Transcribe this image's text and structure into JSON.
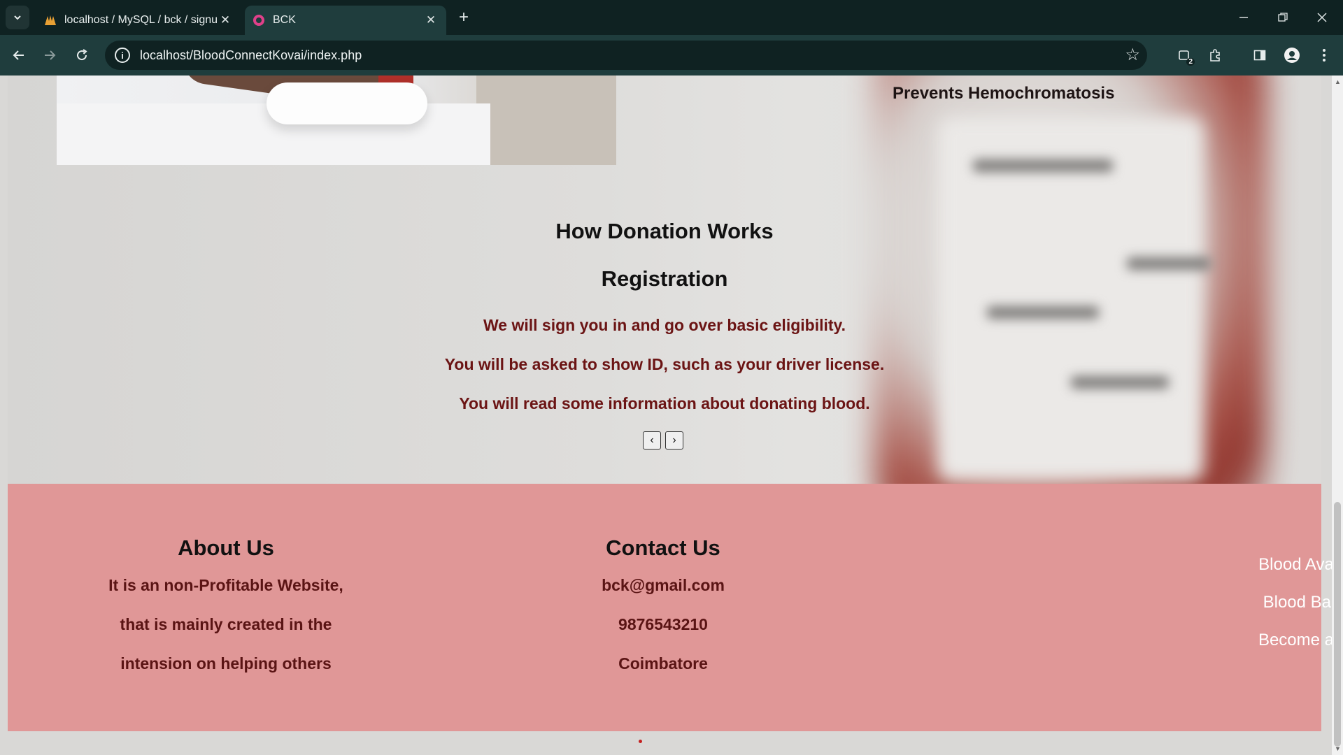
{
  "browser": {
    "tabs": [
      {
        "title": "localhost / MySQL / bck / signu",
        "active": false
      },
      {
        "title": "BCK",
        "active": true
      }
    ],
    "url": "localhost/BloodConnectKovai/index.php",
    "extension_badge": "2"
  },
  "hero": {
    "benefit_text": "Prevents Hemochromatosis",
    "section_title": "How Donation Works",
    "step_title": "Registration",
    "step_lines": [
      "We will sign you in and go over basic eligibility.",
      "You will be asked to show ID, such as your driver license.",
      "You will read some information about donating blood."
    ],
    "prev_label": "‹",
    "next_label": "›"
  },
  "footer": {
    "about": {
      "title": "About Us",
      "lines": [
        "It is an non-Profitable Website,",
        "that is mainly created in the",
        "intension on helping others"
      ]
    },
    "contact": {
      "title": "Contact Us",
      "lines": [
        "bck@gmail.com",
        "9876543210",
        "Coimbatore"
      ]
    },
    "links": [
      "Blood Availability",
      "Blood Bank List",
      "Become a Donor"
    ]
  },
  "colors": {
    "footer_bg": "#e09797",
    "step_text": "#6b1414",
    "chrome_dark": "#0f2222",
    "chrome_toolbar": "#1f3d3d"
  }
}
